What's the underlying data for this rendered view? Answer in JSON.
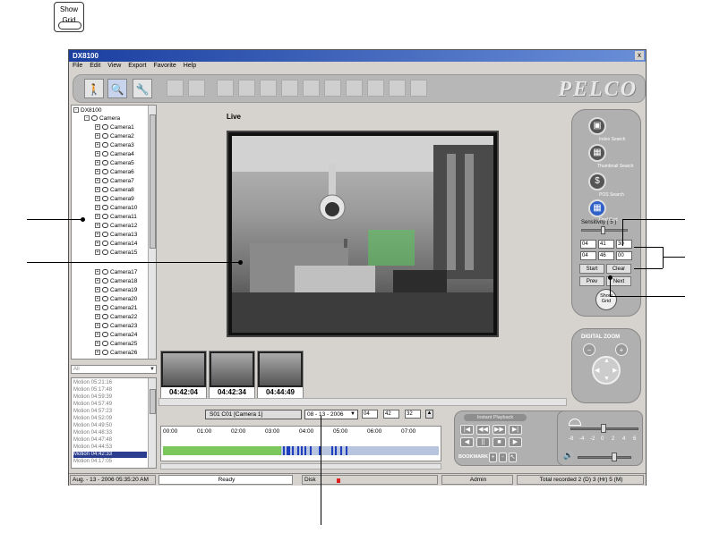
{
  "top_icon": {
    "label_line1": "Show",
    "label_line2": "Grid"
  },
  "window": {
    "title": "DX8100",
    "close": "x"
  },
  "menu": [
    "File",
    "Edit",
    "View",
    "Export",
    "Favorite",
    "Help"
  ],
  "brand": "PELCO",
  "tree": {
    "root": "DX8100",
    "group": "Camera",
    "cameras_top": [
      "Camera1",
      "Camera2",
      "Camera3",
      "Camera4",
      "Camera5",
      "Camera6",
      "Camera7",
      "Camera8",
      "Camera9",
      "Camera10",
      "Camera11",
      "Camera12",
      "Camera13",
      "Camera14",
      "Camera15"
    ],
    "cameras_bottom": [
      "Camera17",
      "Camera18",
      "Camera19",
      "Camera20",
      "Camera21",
      "Camera22",
      "Camera23",
      "Camera24",
      "Camera25",
      "Camera26"
    ]
  },
  "live_label": "Live",
  "right_panel": {
    "index_search": "Index Search",
    "thumbnail_search": "Thumbnail Search",
    "pos_search": "POS Search",
    "grid_label": "Find Grid",
    "sensitivity_label": "Sensitivity ( 5 )",
    "row1": [
      "04",
      "41",
      "30"
    ],
    "row2": [
      "04",
      "46",
      "00"
    ],
    "start": "Start",
    "clear": "Clear",
    "prev": "Prev",
    "next": "Next",
    "show_grid_line1": "Show",
    "show_grid_line2": "Grid"
  },
  "digital_zoom": "DIGITAL ZOOM",
  "thumbnails": [
    "04:42:04",
    "04:42:34",
    "04:44:49"
  ],
  "motion": {
    "filter": "All",
    "events": [
      "Motion 05:21:16",
      "Motion 05:17:48",
      "Motion 04:59:39",
      "Motion 04:57:49",
      "Motion 04:57:23",
      "Motion 04:52:09",
      "Motion 04:49:50",
      "Motion 04:48:33",
      "Motion 04:47:48",
      "Motion 04:44:53",
      "Motion 04:42:33",
      "Motion 04:17:05"
    ],
    "selected_index": 10
  },
  "timeline": {
    "camera": "S01 C01 [Camera 1]",
    "date": "08 - 13 - 2006",
    "time": [
      "04",
      "42",
      "32"
    ],
    "hours": [
      "00:00",
      "01:00",
      "02:00",
      "03:00",
      "04:00",
      "05:00",
      "06:00",
      "07:00"
    ]
  },
  "playback": {
    "label": "Instant Playback",
    "bookmark": "BOOKMARK"
  },
  "volume_scale": [
    "-8",
    "-4",
    "-2",
    "0",
    "2",
    "4",
    "6"
  ],
  "status": {
    "datetime": "Aug. - 13 - 2006  05:35:20 AM",
    "state": "Ready",
    "disk": "Disk",
    "user": "Admin",
    "recorded": "Total recorded 2 (D) 3 (Hr) 5 (M)"
  }
}
